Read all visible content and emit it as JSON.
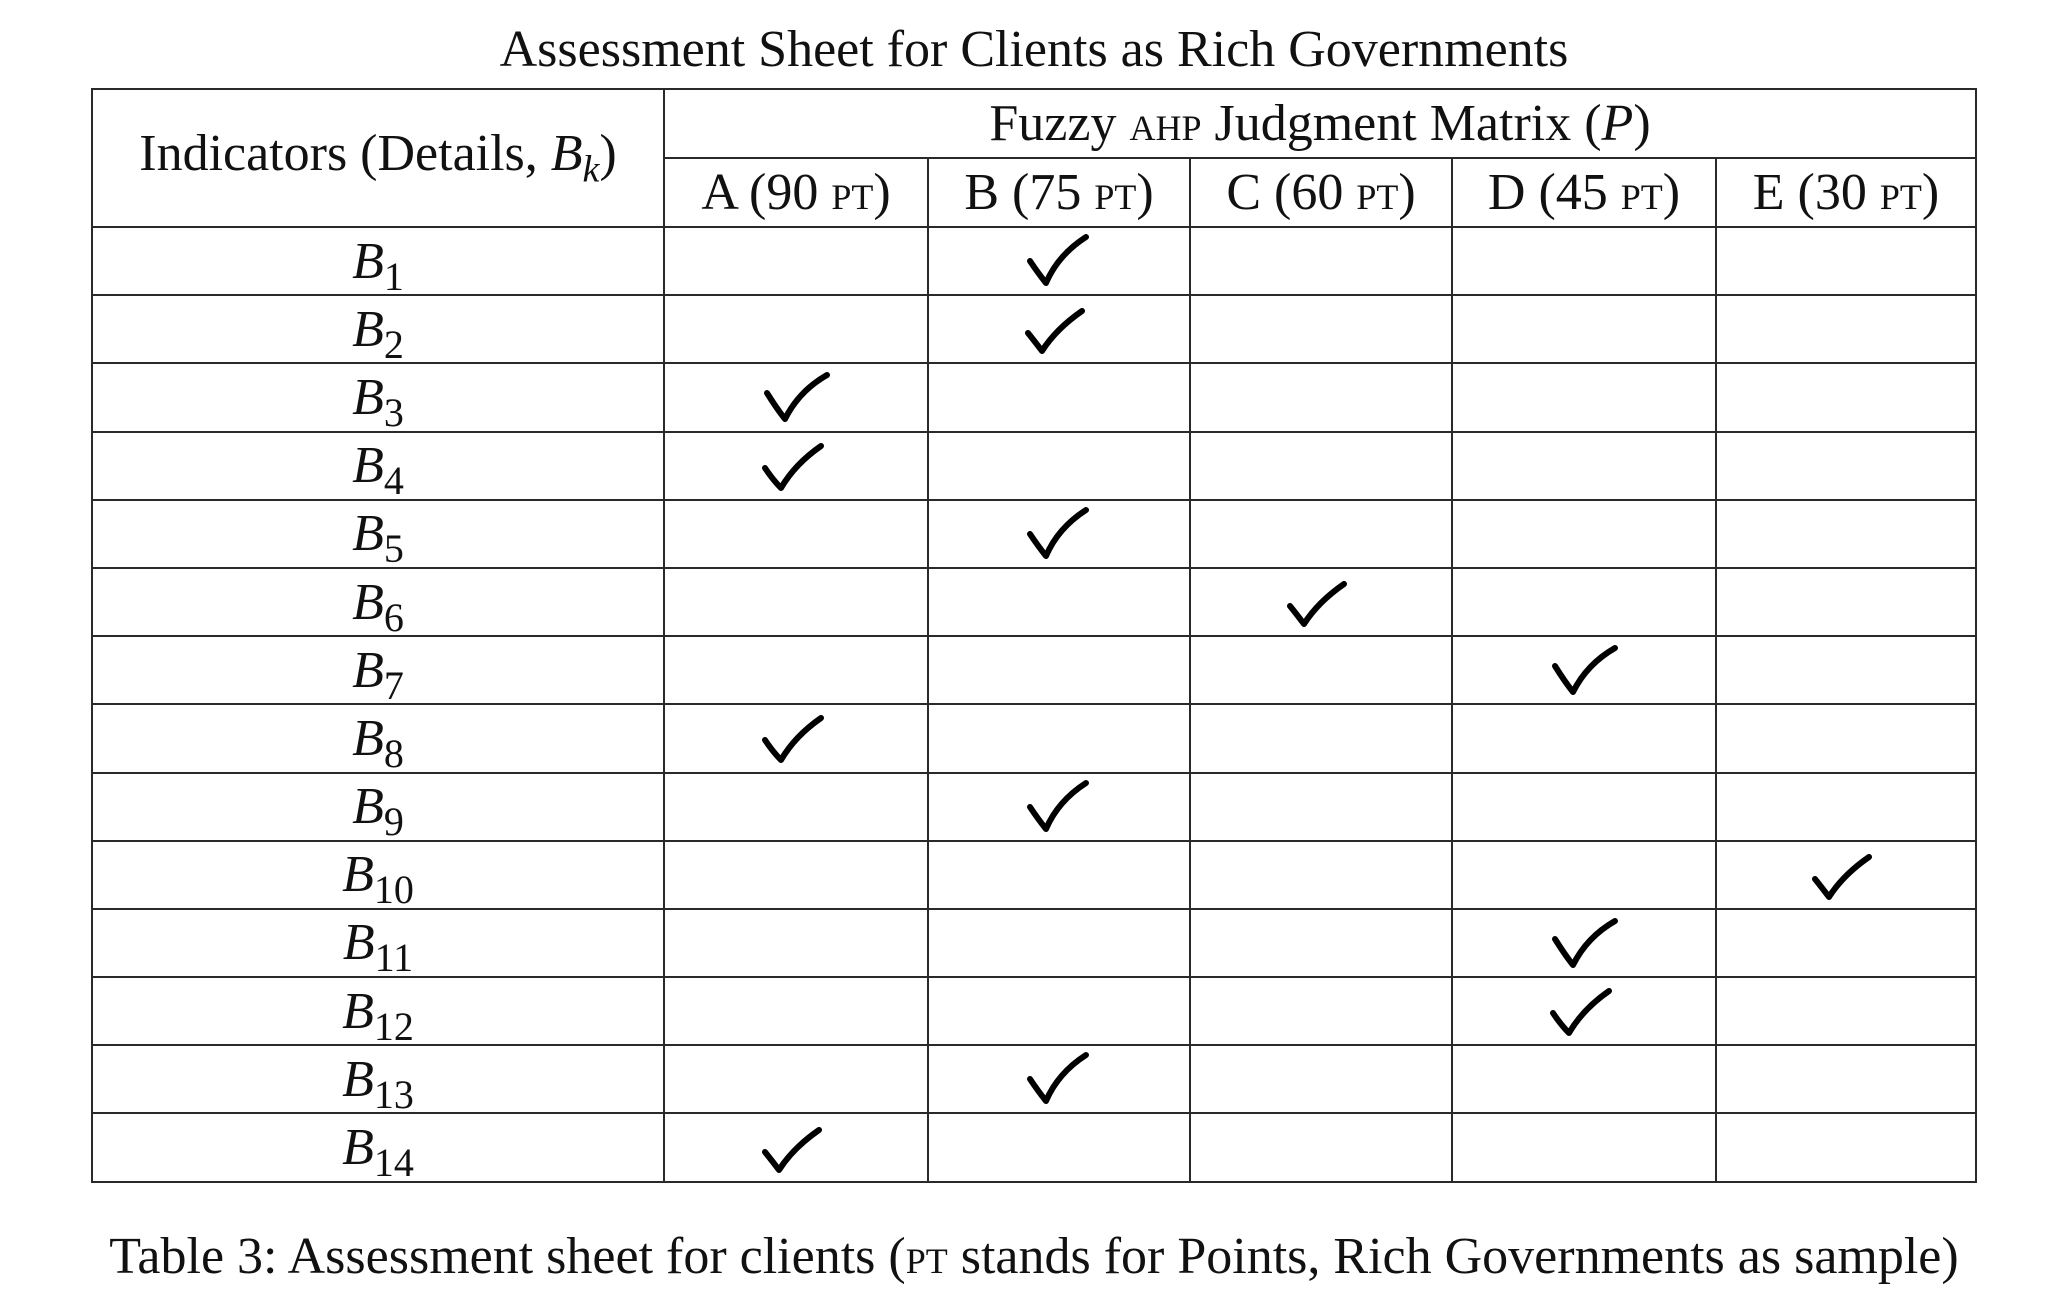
{
  "title": "Assessment Sheet for Clients as Rich Governments",
  "header": {
    "indicator_label": "Indicators (Details, ",
    "indicator_symbol": "B",
    "indicator_sub": "k",
    "indicator_close": ")",
    "matrix_prefix": "Fuzzy ",
    "matrix_abbrev": "ahp",
    "matrix_suffix": " Judgment Matrix (",
    "matrix_symbol": "P",
    "matrix_close": ")",
    "columns": [
      {
        "label": "A (90 ",
        "unit": "pt",
        "close": ")"
      },
      {
        "label": "B (75 ",
        "unit": "pt",
        "close": ")"
      },
      {
        "label": "C (60 ",
        "unit": "pt",
        "close": ")"
      },
      {
        "label": "D (45 ",
        "unit": "pt",
        "close": ")"
      },
      {
        "label": "E (30 ",
        "unit": "pt",
        "close": ")"
      }
    ]
  },
  "rows": [
    {
      "symbol": "B",
      "sub": "1",
      "checked_column": "B"
    },
    {
      "symbol": "B",
      "sub": "2",
      "checked_column": "B"
    },
    {
      "symbol": "B",
      "sub": "3",
      "checked_column": "A"
    },
    {
      "symbol": "B",
      "sub": "4",
      "checked_column": "A"
    },
    {
      "symbol": "B",
      "sub": "5",
      "checked_column": "B"
    },
    {
      "symbol": "B",
      "sub": "6",
      "checked_column": "C"
    },
    {
      "symbol": "B",
      "sub": "7",
      "checked_column": "D"
    },
    {
      "symbol": "B",
      "sub": "8",
      "checked_column": "A"
    },
    {
      "symbol": "B",
      "sub": "9",
      "checked_column": "B"
    },
    {
      "symbol": "B",
      "sub": "10",
      "checked_column": "E"
    },
    {
      "symbol": "B",
      "sub": "11",
      "checked_column": "D"
    },
    {
      "symbol": "B",
      "sub": "12",
      "checked_column": "D"
    },
    {
      "symbol": "B",
      "sub": "13",
      "checked_column": "B"
    },
    {
      "symbol": "B",
      "sub": "14",
      "checked_column": "A"
    }
  ],
  "caption": {
    "prefix": "Table 3:  Assessment sheet for clients (",
    "abbrev": "pt",
    "suffix": " stands for Points, Rich Governments as sample)"
  }
}
